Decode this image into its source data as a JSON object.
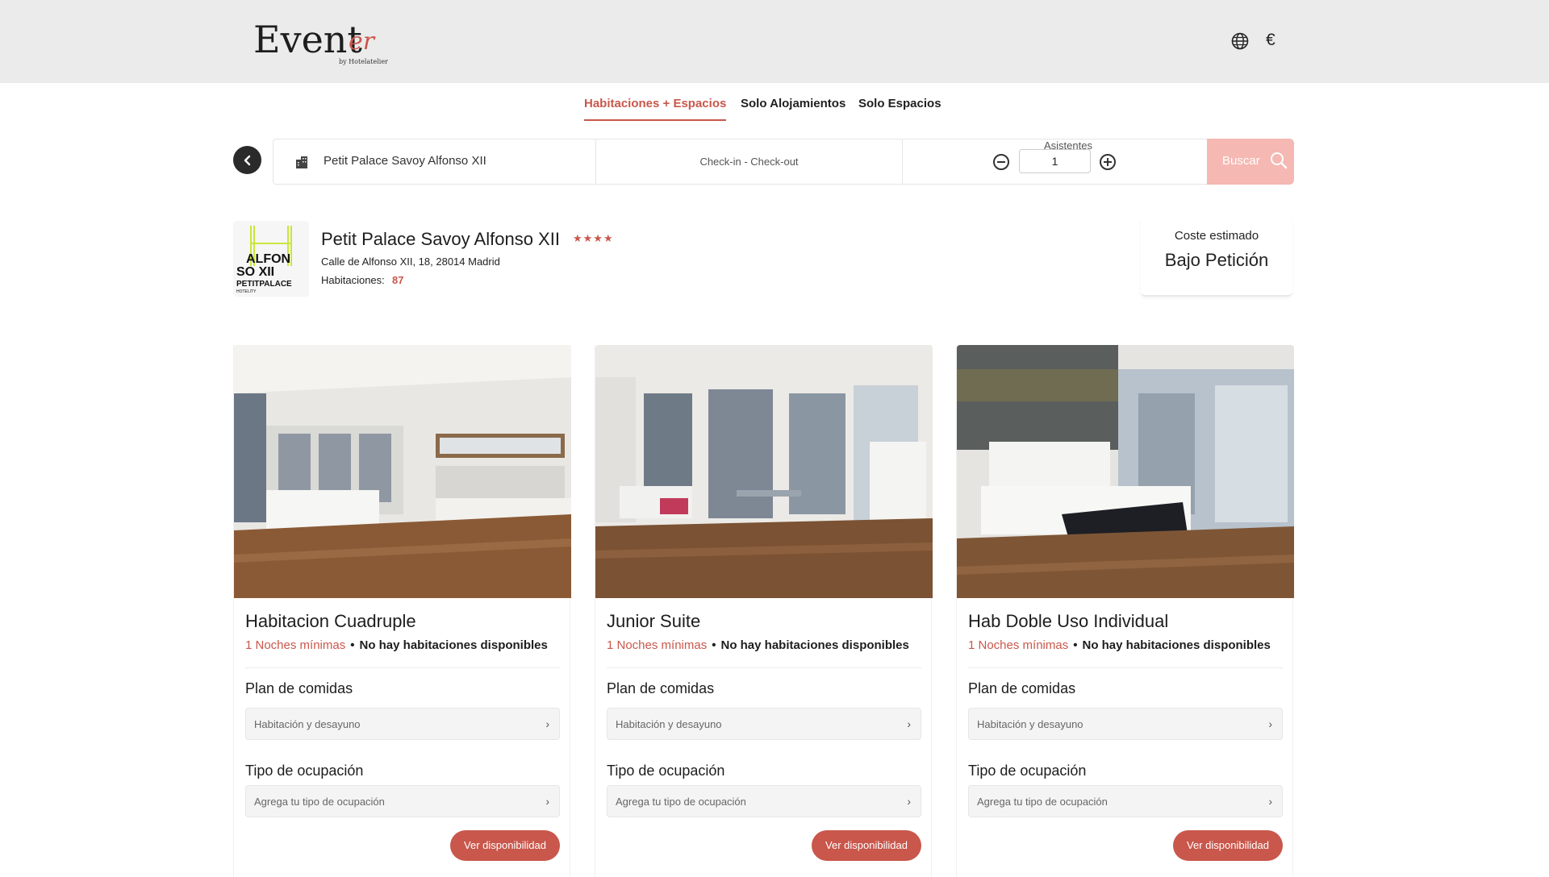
{
  "header": {
    "logo_main": "Event",
    "logo_script": "er",
    "logo_by": "by Hotelatelier",
    "currency": "€",
    "language_icon": "globe-icon"
  },
  "tabs": [
    {
      "label": "Habitaciones + Espacios",
      "active": true
    },
    {
      "label": "Solo Alojamientos",
      "active": false
    },
    {
      "label": "Solo Espacios",
      "active": false
    }
  ],
  "search": {
    "hotel": "Petit Palace Savoy Alfonso XII",
    "dates": "Check-in - Check-out",
    "attendees_label": "Asistentes",
    "attendees_value": "1",
    "search_label": "Buscar"
  },
  "hotel": {
    "name": "Petit Palace Savoy Alfonso XII",
    "stars": "★★★★",
    "address": "Calle de Alfonso XII, 18, 28014 Madrid",
    "rooms_label": "Habitaciones:",
    "rooms_value": "87",
    "logo_text_1": "ALFON",
    "logo_text_2": "SO XII",
    "logo_text_3": "PETITPALACE",
    "logo_text_4": "HOTELITY"
  },
  "cost": {
    "label": "Coste estimado",
    "value": "Bajo Petición"
  },
  "rooms": [
    {
      "title": "Habitacion Cuadruple",
      "min_nights": "1 Noches mínimas",
      "availability": "No hay habitaciones disponibles",
      "meal_label": "Plan de comidas",
      "meal_value": "Habitación y desayuno",
      "occupancy_label": "Tipo de ocupación",
      "occupancy_placeholder": "Agrega tu tipo de ocupación",
      "button": "Ver disponibilidad"
    },
    {
      "title": "Junior Suite",
      "min_nights": "1 Noches mínimas",
      "availability": "No hay habitaciones disponibles",
      "meal_label": "Plan de comidas",
      "meal_value": "Habitación y desayuno",
      "occupancy_label": "Tipo de ocupación",
      "occupancy_placeholder": "Agrega tu tipo de ocupación",
      "button": "Ver disponibilidad"
    },
    {
      "title": "Hab Doble Uso Individual",
      "min_nights": "1 Noches mínimas",
      "availability": "No hay habitaciones disponibles",
      "meal_label": "Plan de comidas",
      "meal_value": "Habitación y desayuno",
      "occupancy_label": "Tipo de ocupación",
      "occupancy_placeholder": "Agrega tu tipo de ocupación",
      "button": "Ver disponibilidad"
    }
  ],
  "colors": {
    "accent": "#c9574b",
    "search_button": "#f5b8b2",
    "header_bg": "#ebebeb"
  }
}
